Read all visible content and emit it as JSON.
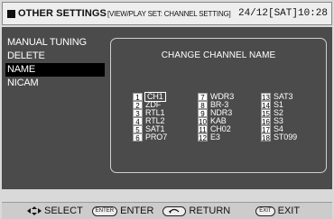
{
  "header": {
    "title": "OTHER SETTINGS",
    "path": "[VIEW/PLAY SET: CHANNEL SETTING]",
    "datetime": "24/12[SAT]10:28"
  },
  "menu": [
    {
      "label": "MANUAL TUNING",
      "selected": false
    },
    {
      "label": "DELETE",
      "selected": false
    },
    {
      "label": "NAME",
      "selected": true
    },
    {
      "label": "NICAM",
      "selected": false
    }
  ],
  "panel": {
    "title": "CHANGE CHANNEL NAME",
    "columns": [
      [
        {
          "num": "1",
          "name": "CH1"
        },
        {
          "num": "2",
          "name": "ZDF"
        },
        {
          "num": "3",
          "name": "RTL1"
        },
        {
          "num": "4",
          "name": "RTL2"
        },
        {
          "num": "5",
          "name": "SAT1"
        },
        {
          "num": "6",
          "name": "PRO7"
        }
      ],
      [
        {
          "num": "7",
          "name": "WDR3"
        },
        {
          "num": "8",
          "name": "BR-3"
        },
        {
          "num": "9",
          "name": "NDR3"
        },
        {
          "num": "10",
          "name": "KAB"
        },
        {
          "num": "11",
          "name": "CH02"
        },
        {
          "num": "12",
          "name": "E3"
        }
      ],
      [
        {
          "num": "13",
          "name": "SAT3"
        },
        {
          "num": "14",
          "name": "S1"
        },
        {
          "num": "15",
          "name": "S2"
        },
        {
          "num": "16",
          "name": "S3"
        },
        {
          "num": "17",
          "name": "S4"
        },
        {
          "num": "18",
          "name": "ST099"
        }
      ]
    ]
  },
  "footer": {
    "select_label": "SELECT",
    "enter_icon_text": "ENTER",
    "enter_label": "ENTER",
    "return_label": "RETURN",
    "exit_icon_text": "EXIT",
    "exit_label": "EXIT"
  },
  "colors": {
    "background": "#4b4b4b",
    "header": "#eeeeee",
    "footer": "#cccccc",
    "selected": "#000000"
  }
}
